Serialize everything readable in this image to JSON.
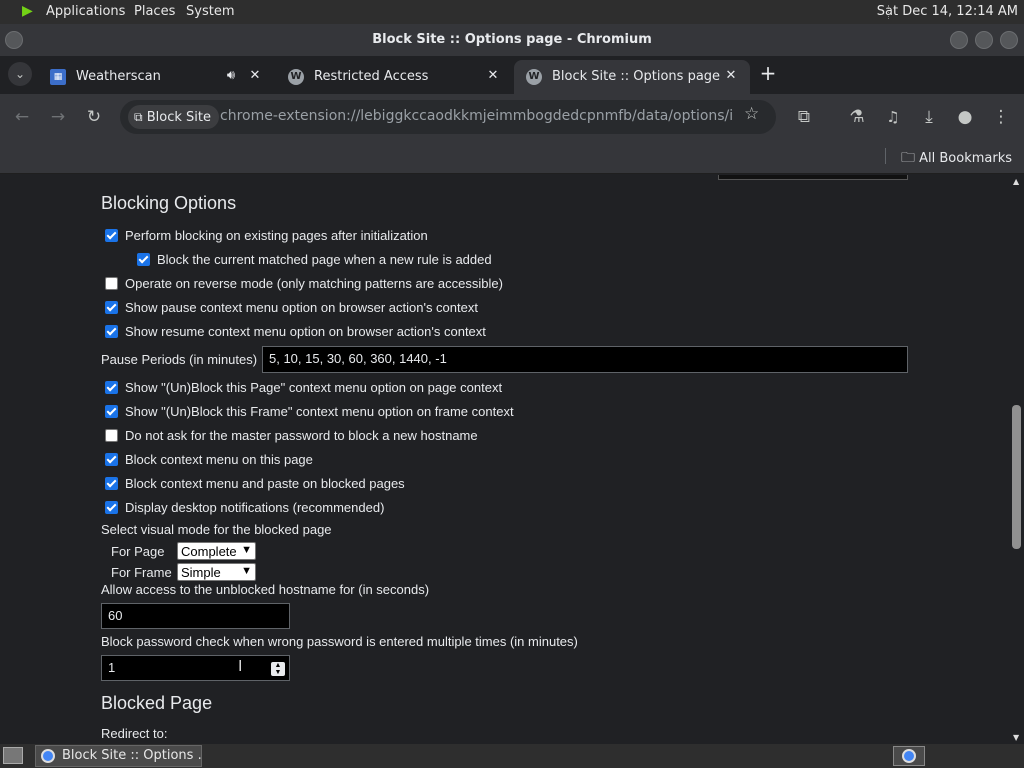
{
  "top_panel": {
    "menus": [
      "Applications",
      "Places",
      "System"
    ],
    "clock": "Sat Dec 14, 12:14 AM"
  },
  "window": {
    "title": "Block Site :: Options page - Chromium"
  },
  "tabs": [
    {
      "label": "Weatherscan",
      "favicon": "weatherscan-favicon",
      "audio": true
    },
    {
      "label": "Restricted Access",
      "favicon": "W"
    },
    {
      "label": "Block Site :: Options page",
      "favicon": "W",
      "active": true
    }
  ],
  "toolbar": {
    "site_chip": "Block Site",
    "url": "chrome-extension://lebiggkccaodkkmjeimmbogdedcpnmfb/data/options/index...."
  },
  "bookmarks": {
    "all_bookmarks": "All Bookmarks"
  },
  "page": {
    "blocking_heading": "Blocking Options",
    "options": [
      {
        "label": "Perform blocking on existing pages after initialization",
        "checked": true
      },
      {
        "label": "Block the current matched page when a new rule is added",
        "checked": true,
        "indented": true
      },
      {
        "label": "Operate on reverse mode (only matching patterns are accessible)",
        "checked": false
      },
      {
        "label": "Show pause context menu option on browser action's context",
        "checked": true
      },
      {
        "label": "Show resume context menu option on browser action's context",
        "checked": true
      }
    ],
    "pause_label": "Pause Periods (in minutes)",
    "pause_value": "5, 10, 15, 30, 60, 360, 1440, -1",
    "options2": [
      {
        "label": "Show \"(Un)Block this Page\" context menu option on page context",
        "checked": true
      },
      {
        "label": "Show \"(Un)Block this Frame\" context menu option on frame context",
        "checked": true
      },
      {
        "label": "Do not ask for the master password to block a new hostname",
        "checked": false
      },
      {
        "label": "Block context menu on this page",
        "checked": true
      },
      {
        "label": "Block context menu and paste on blocked pages",
        "checked": true
      },
      {
        "label": "Display desktop notifications (recommended)",
        "checked": true
      }
    ],
    "visual_mode_label": "Select visual mode for the blocked page",
    "for_page_label": "For Page",
    "for_page_value": "Complete",
    "for_frame_label": "For Frame",
    "for_frame_value": "Simple",
    "allow_access_label": "Allow access to the unblocked hostname for (in seconds)",
    "allow_access_value": "60",
    "password_check_label": "Block password check when wrong password is entered multiple times (in minutes)",
    "password_check_value": "1",
    "blocked_heading": "Blocked Page",
    "redirect_label": "Redirect to:"
  },
  "taskbar": {
    "task_label": "Block Site :: Options ..."
  },
  "colors": {
    "accent": "#1a73e8",
    "chrome_bg": "#35363a",
    "page_bg": "#202124"
  }
}
